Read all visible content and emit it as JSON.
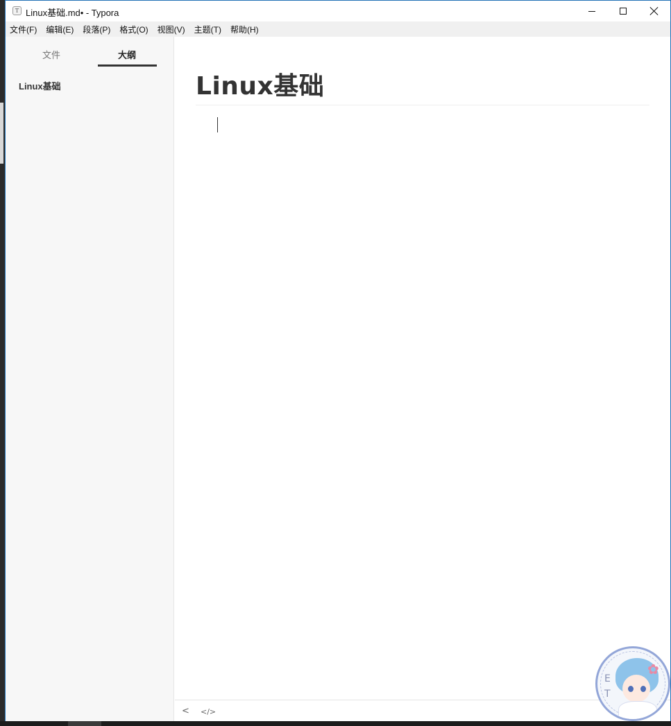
{
  "window": {
    "app_icon_glyph": "T",
    "title": "Linux基础.md• - Typora"
  },
  "menu": {
    "items": [
      "文件(F)",
      "编辑(E)",
      "段落(P)",
      "格式(O)",
      "视图(V)",
      "主题(T)",
      "帮助(H)"
    ]
  },
  "sidebar": {
    "tabs": [
      {
        "label": "文件",
        "active": false
      },
      {
        "label": "大纲",
        "active": true
      }
    ],
    "outline": [
      "Linux基础"
    ]
  },
  "editor": {
    "heading": "Linux基础"
  },
  "footer": {
    "back_icon": "<",
    "source_icon": "</>"
  },
  "avatar": {
    "letters": [
      "E",
      "T"
    ]
  }
}
